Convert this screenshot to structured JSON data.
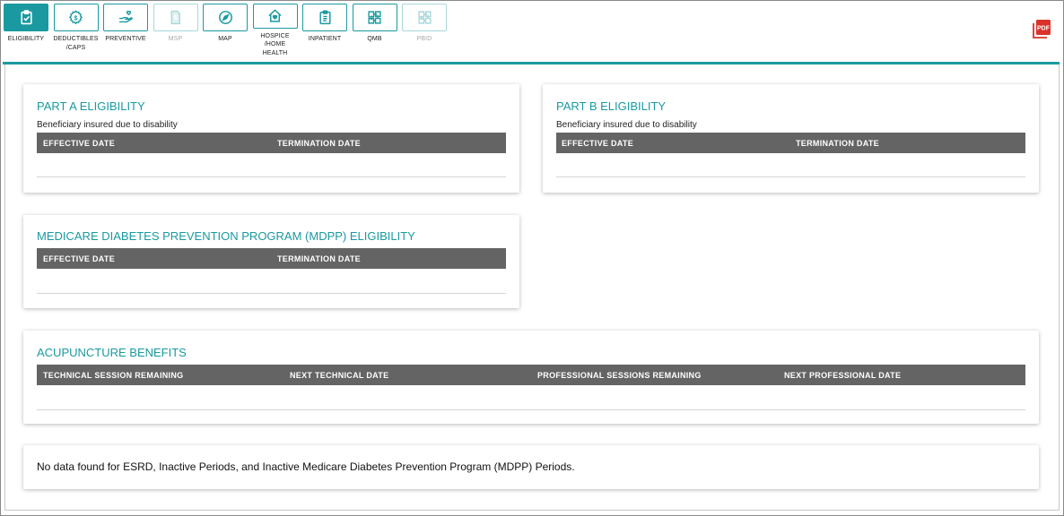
{
  "toolbar": {
    "items": [
      {
        "label": "ELIGIBILITY",
        "icon": "checklist-icon",
        "state": "active"
      },
      {
        "label": "DEDUCTIBLES\n/CAPS",
        "icon": "dollar-gear-icon",
        "state": "normal"
      },
      {
        "label": "PREVENTIVE",
        "icon": "hand-heart-icon",
        "state": "normal"
      },
      {
        "label": "MSP",
        "icon": "dollar-document-icon",
        "state": "disabled"
      },
      {
        "label": "MAP",
        "icon": "compass-icon",
        "state": "normal"
      },
      {
        "label": "HOSPICE\n/HOME HEALTH",
        "icon": "home-heart-icon",
        "state": "normal"
      },
      {
        "label": "INPATIENT",
        "icon": "clipboard-icon",
        "state": "normal"
      },
      {
        "label": "QMB",
        "icon": "puzzle-icon",
        "state": "normal"
      },
      {
        "label": "PBID",
        "icon": "puzzle-icon",
        "state": "disabled"
      }
    ],
    "pdf_label": "PDF"
  },
  "colors": {
    "accent": "#1a9aa0",
    "header_bg": "#646464",
    "pdf_red": "#d9322b"
  },
  "part_a": {
    "title": "PART A ELIGIBILITY",
    "subtitle": "Beneficiary insured due to disability",
    "columns": [
      "EFFECTIVE DATE",
      "TERMINATION DATE"
    ]
  },
  "part_b": {
    "title": "PART B ELIGIBILITY",
    "subtitle": "Beneficiary insured due to disability",
    "columns": [
      "EFFECTIVE DATE",
      "TERMINATION DATE"
    ]
  },
  "mdpp": {
    "title": "MEDICARE DIABETES PREVENTION PROGRAM (MDPP) ELIGIBILITY",
    "columns": [
      "EFFECTIVE DATE",
      "TERMINATION DATE"
    ]
  },
  "acupuncture": {
    "title": "ACUPUNCTURE BENEFITS",
    "columns": [
      "TECHNICAL SESSION REMAINING",
      "NEXT TECHNICAL DATE",
      "PROFESSIONAL SESSIONS REMAINING",
      "NEXT PROFESSIONAL DATE"
    ]
  },
  "no_data_message": "No data found for ESRD, Inactive Periods, and Inactive Medicare Diabetes Prevention Program (MDPP) Periods."
}
